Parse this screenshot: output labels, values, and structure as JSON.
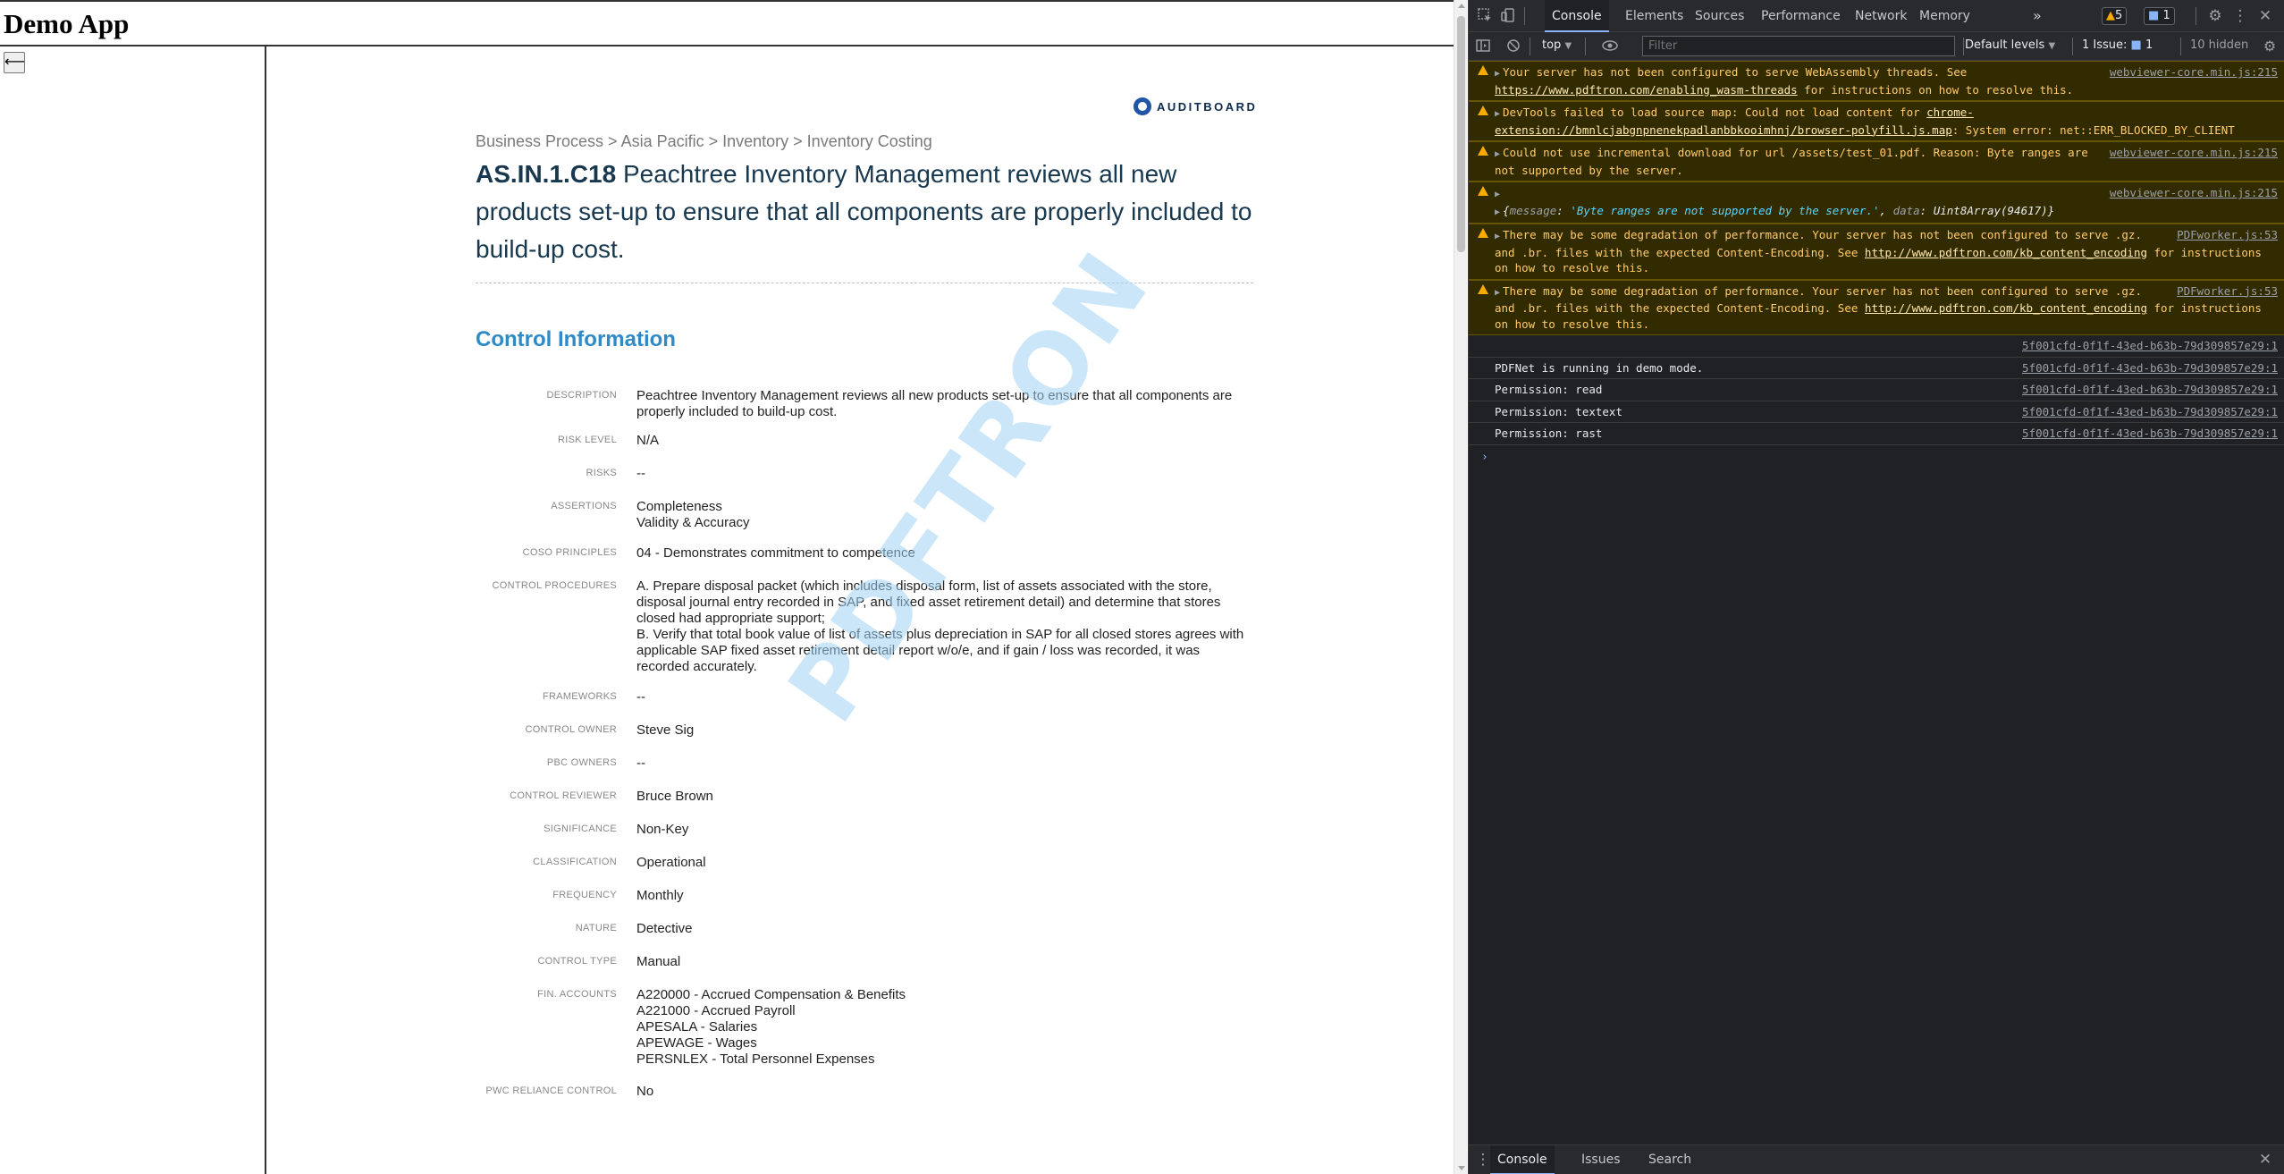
{
  "app": {
    "title": "Demo App",
    "back_label": "⟵"
  },
  "doc": {
    "brand": "AUDITBOARD",
    "breadcrumb": "Business Process > Asia Pacific > Inventory > Inventory Costing",
    "code": "AS.IN.1.C18",
    "title": " Peachtree Inventory Management reviews all new products set-up to ensure that all components are properly included to build-up cost.",
    "section_title": "Control Information",
    "watermark": "PDFTRON",
    "fields": [
      {
        "label": "DESCRIPTION",
        "value": "Peachtree Inventory Management reviews all new products set-up to ensure that all components are properly included to build-up cost."
      },
      {
        "label": "RISK LEVEL",
        "value": "N/A"
      },
      {
        "label": "RISKS",
        "value": "--"
      },
      {
        "label": "ASSERTIONS",
        "value": "Completeness\nValidity & Accuracy"
      },
      {
        "label": "COSO PRINCIPLES",
        "value": "04 - Demonstrates commitment to competence"
      },
      {
        "label": "CONTROL PROCEDURES",
        "value": "A. Prepare disposal packet (which includes disposal form, list of assets associated with the store, disposal journal entry recorded in SAP, and fixed asset retirement detail) and determine that stores closed had appropriate support;\nB. Verify that total book value of list of assets plus depreciation in SAP for all closed stores agrees with applicable SAP fixed asset retirement detail report w/o/e, and if gain / loss was recorded, it was recorded accurately."
      },
      {
        "label": "FRAMEWORKS",
        "value": "--"
      },
      {
        "label": "CONTROL OWNER",
        "value": "Steve Sig"
      },
      {
        "label": "PBC OWNERS",
        "value": "--"
      },
      {
        "label": "CONTROL REVIEWER",
        "value": "Bruce Brown"
      },
      {
        "label": "SIGNIFICANCE",
        "value": "Non-Key"
      },
      {
        "label": "CLASSIFICATION",
        "value": "Operational"
      },
      {
        "label": "FREQUENCY",
        "value": "Monthly"
      },
      {
        "label": "NATURE",
        "value": "Detective"
      },
      {
        "label": "CONTROL TYPE",
        "value": "Manual"
      },
      {
        "label": "FIN. ACCOUNTS",
        "value": "A220000 - Accrued Compensation & Benefits\nA221000 - Accrued Payroll\nAPESALA - Salaries\nAPEWAGE - Wages\nPERSNLEX - Total Personnel Expenses"
      },
      {
        "label": "PWC RELIANCE CONTROL",
        "value": "No"
      }
    ]
  },
  "devtools": {
    "tabs": [
      "Console",
      "Elements",
      "Sources",
      "Performance",
      "Network",
      "Memory"
    ],
    "more_tabs": "»",
    "warn_count": "5",
    "msg_count": "1",
    "context": "top",
    "filter_placeholder": "Filter",
    "levels": "Default levels",
    "issues": "1 Issue:",
    "issues_count": "1",
    "hidden": "10 hidden",
    "messages": [
      {
        "type": "warn",
        "src": "webviewer-core.min.js:215",
        "text": "Your server has not been configured to serve WebAssembly threads. See ",
        "link": "https://www.pdftron.com/enabling_wasm-threads",
        "after": " for instructions on how to resolve this."
      },
      {
        "type": "warn",
        "src": "",
        "text": "DevTools failed to load source map: Could not load content for ",
        "link": "chrome-extension://bmnlcjabgnpnenekpadlanbbkooimhnj/browser-polyfill.js.map",
        "after": ": System error: net::ERR_BLOCKED_BY_CLIENT"
      },
      {
        "type": "warn",
        "src": "webviewer-core.min.js:215",
        "text": "Could not use incremental download for url /assets/test_01.pdf. Reason: Byte ranges are not supported by the server.",
        "link": "",
        "after": ""
      },
      {
        "type": "warn",
        "src": "webviewer-core.min.js:215",
        "text": "",
        "link": "",
        "after": "",
        "object": "{message: 'Byte ranges are not supported by the server.', data: Uint8Array(94617)}"
      },
      {
        "type": "warn",
        "src": "PDFworker.js:53",
        "text": "There may be some degradation of performance. Your server has not been configured to serve .gz. and .br. files with the expected Content-Encoding. See ",
        "link": "http://www.pdftron.com/kb_content_encoding",
        "after": " for instructions on how to resolve this."
      },
      {
        "type": "warn",
        "src": "PDFworker.js:53",
        "text": "There may be some degradation of performance. Your server has not been configured to serve .gz. and .br. files with the expected Content-Encoding. See ",
        "link": "http://www.pdftron.com/kb_content_encoding",
        "after": " for instructions on how to resolve this."
      },
      {
        "type": "info",
        "src": "5f001cfd-0f1f-43ed-b63b-79d309857e29:1",
        "text": "",
        "link": "",
        "after": ""
      },
      {
        "type": "info",
        "src": "5f001cfd-0f1f-43ed-b63b-79d309857e29:1",
        "text": "PDFNet is running in demo mode.",
        "link": "",
        "after": ""
      },
      {
        "type": "info",
        "src": "5f001cfd-0f1f-43ed-b63b-79d309857e29:1",
        "text": "Permission: read",
        "link": "",
        "after": ""
      },
      {
        "type": "info",
        "src": "5f001cfd-0f1f-43ed-b63b-79d309857e29:1",
        "text": "Permission: textext",
        "link": "",
        "after": ""
      },
      {
        "type": "info",
        "src": "5f001cfd-0f1f-43ed-b63b-79d309857e29:1",
        "text": "Permission: rast",
        "link": "",
        "after": ""
      }
    ],
    "prompt": "›",
    "drawer_tabs": [
      "Console",
      "Issues",
      "Search"
    ]
  },
  "colors": {
    "accent": "#8ab4f8",
    "warning_bg": "#332b00",
    "warning_text": "#ffcb6b",
    "section_title": "#2f8ac7",
    "title": "#17384f",
    "brand": "#2155a6"
  },
  "icons": {
    "inspect": "inspect-element-icon",
    "device": "device-toolbar-icon",
    "settings": "gear-icon",
    "more": "kebab-menu-icon",
    "close": "close-icon",
    "sidebar": "sidebar-toggle-icon",
    "clear": "clear-console-icon",
    "eye": "live-expression-icon",
    "warning": "warning-icon"
  }
}
